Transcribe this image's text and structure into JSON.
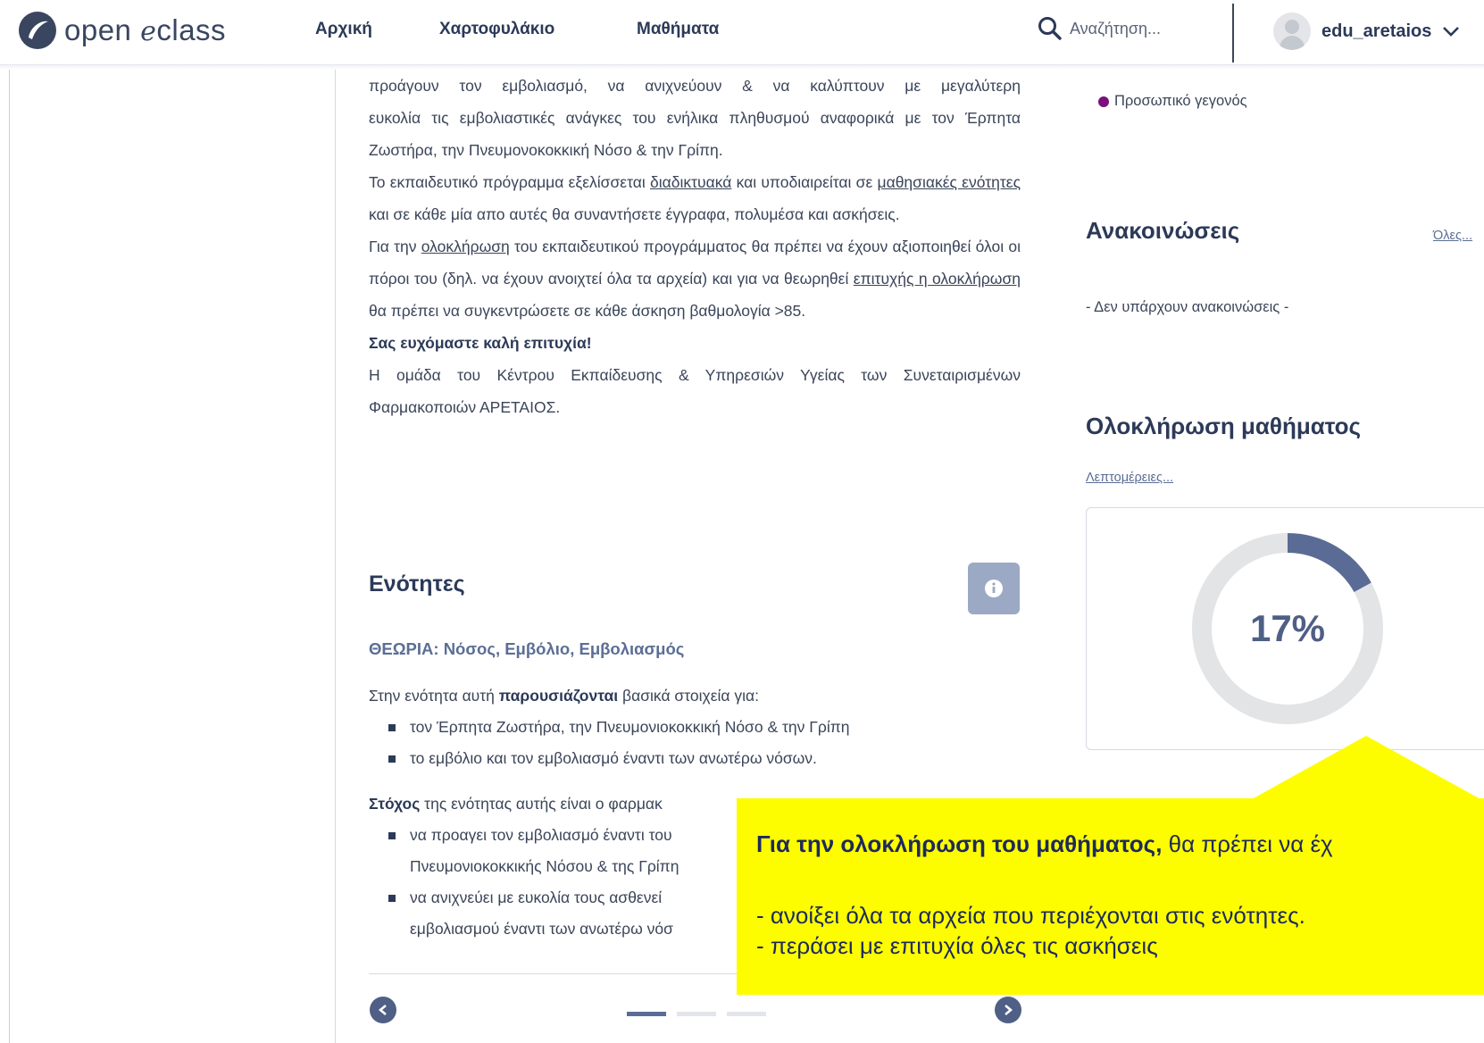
{
  "header": {
    "logo": {
      "prefix": "open ",
      "e": "e",
      "suffix": "class"
    },
    "nav": [
      "Αρχική",
      "Χαρτοφυλάκιο",
      "Μαθήματα"
    ],
    "search_placeholder": "Αναζήτηση...",
    "username": "edu_aretaios"
  },
  "main": {
    "p1_line1": "προάγουν τον εμβολιασμό, να ανιχνεύουν & να καλύπτουν με μεγαλύτερη",
    "p1_rest": "ευκολία τις εμβολιαστικές ανάγκες του ενήλικα πληθυσμού αναφορικά με τον Έρπητα Ζωστήρα, την Πνευμονοκοκκική Νόσο & την Γρίπη.",
    "p2_a": "Το εκπαιδευτικό πρόγραμμα εξελίσσεται ",
    "p2_link1": "διαδικτυακά",
    "p2_b": " και υποδιαιρείται σε ",
    "p2_link2": "μαθησιακές ενότητες",
    "p2_c": " και σε κάθε μία απο αυτές θα συναντήσετε έγγραφα, πολυμέσα και ασκήσεις.",
    "p3_a": "Για την ",
    "p3_link1": "ολοκλήρωση",
    "p3_b": " του εκπαιδευτικού προγράμματος θα πρέπει να έχουν αξιοποιηθεί όλοι οι πόροι του (δηλ. να έχουν ανοιχτεί όλα τα αρχεία) και για να θεωρηθεί ",
    "p3_link2": "επιτυχής η ολοκλήρωση",
    "p3_c": " θα πρέπει να συγκεντρώσετε σε κάθε άσκηση βαθμολογία >85.",
    "wish": "Σας ευχόμαστε καλή επιτυχία!",
    "signature": "Η ομάδα του Κέντρου Εκπαίδευσης & Υπηρεσιών Υγείας των Συνεταιρισμένων Φαρμακοποιών ΑΡΕΤΑΙΟΣ."
  },
  "units": {
    "title": "Ενότητες",
    "unit_title": "ΘΕΩΡΙΑ: Νόσος, Εμβόλιο, Εμβολιασμός",
    "intro_a": "Στην ενότητα αυτή ",
    "intro_bold": "παρουσιάζονται",
    "intro_b": " βασικά στοιχεία για:",
    "bullets1": [
      "τον Έρπητα Ζωστήρα, την Πνευμονιοκοκκική Νόσο & την Γρίπη",
      "το εμβόλιο και τον εμβολιασμό έναντι των ανωτέρω νόσων."
    ],
    "goal_bold": "Στόχος",
    "goal_rest": " της ενότητας αυτής είναι ο φαρμακ",
    "bullet2_1a": "να προαγει τον εμβολιασμό έναντι του",
    "bullet2_1b": "Πνευμονιοκοκκικής Νόσου & της Γρίπη",
    "bullet2_2a": "να ανιχνεύει με ευκολία τους ασθενεί",
    "bullet2_2b": "εμβολιασμού έναντι των ανωτέρω νόσ"
  },
  "sidebar": {
    "legend_personal": "Προσωπικό γεγονός",
    "announcements_title": "Ανακοινώσεις",
    "announcements_all": "Όλες...",
    "announcements_empty": "- Δεν υπάρχουν ανακοινώσεις -",
    "completion_title": "Ολοκλήρωση μαθήματος",
    "completion_details": "Λεπτομέρειες...",
    "progress_label": "17%",
    "progress_value": 0.17
  },
  "callout": {
    "line1_bold": "Για την ολοκλήρωση του μαθήματος,",
    "line1_rest": " θα πρέπει να έχ",
    "line2": "- ανοίξει όλα τα αρχεία που περιέχονται στις ενότητες.",
    "line3": "- περάσει με επιτυχία όλες τις ασκήσεις"
  },
  "colors": {
    "accent": "#5a6c95",
    "callout": "#fdfd00",
    "legend_personal": "#7b0f7e"
  }
}
